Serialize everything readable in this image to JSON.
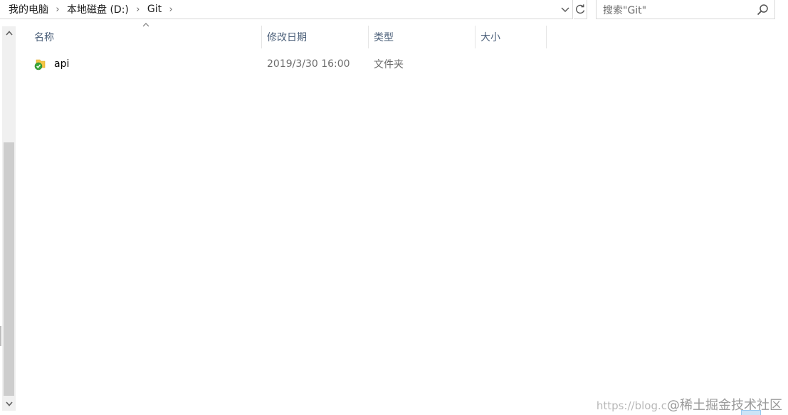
{
  "breadcrumb": {
    "items": [
      "我的电脑",
      "本地磁盘 (D:)",
      "Git"
    ],
    "separator": "›"
  },
  "search": {
    "placeholder": "搜索\"Git\""
  },
  "columns": [
    {
      "label": "名称"
    },
    {
      "label": "修改日期"
    },
    {
      "label": "类型"
    },
    {
      "label": "大小"
    }
  ],
  "files": [
    {
      "name": "api",
      "modified": "2019/3/30 16:00",
      "type": "文件夹",
      "size": "",
      "icon": "git-synced-folder-icon"
    }
  ],
  "watermark": {
    "url": "https://blog.c",
    "site": "@稀土掘金技术社区"
  },
  "colors": {
    "header_text": "#4c607a",
    "secondary_text": "#6d6d6d",
    "border": "#d9d9d9",
    "scroll_thumb": "#cdcdcd",
    "folder_yellow": "#f5c542",
    "sync_green": "#3aa63a"
  }
}
